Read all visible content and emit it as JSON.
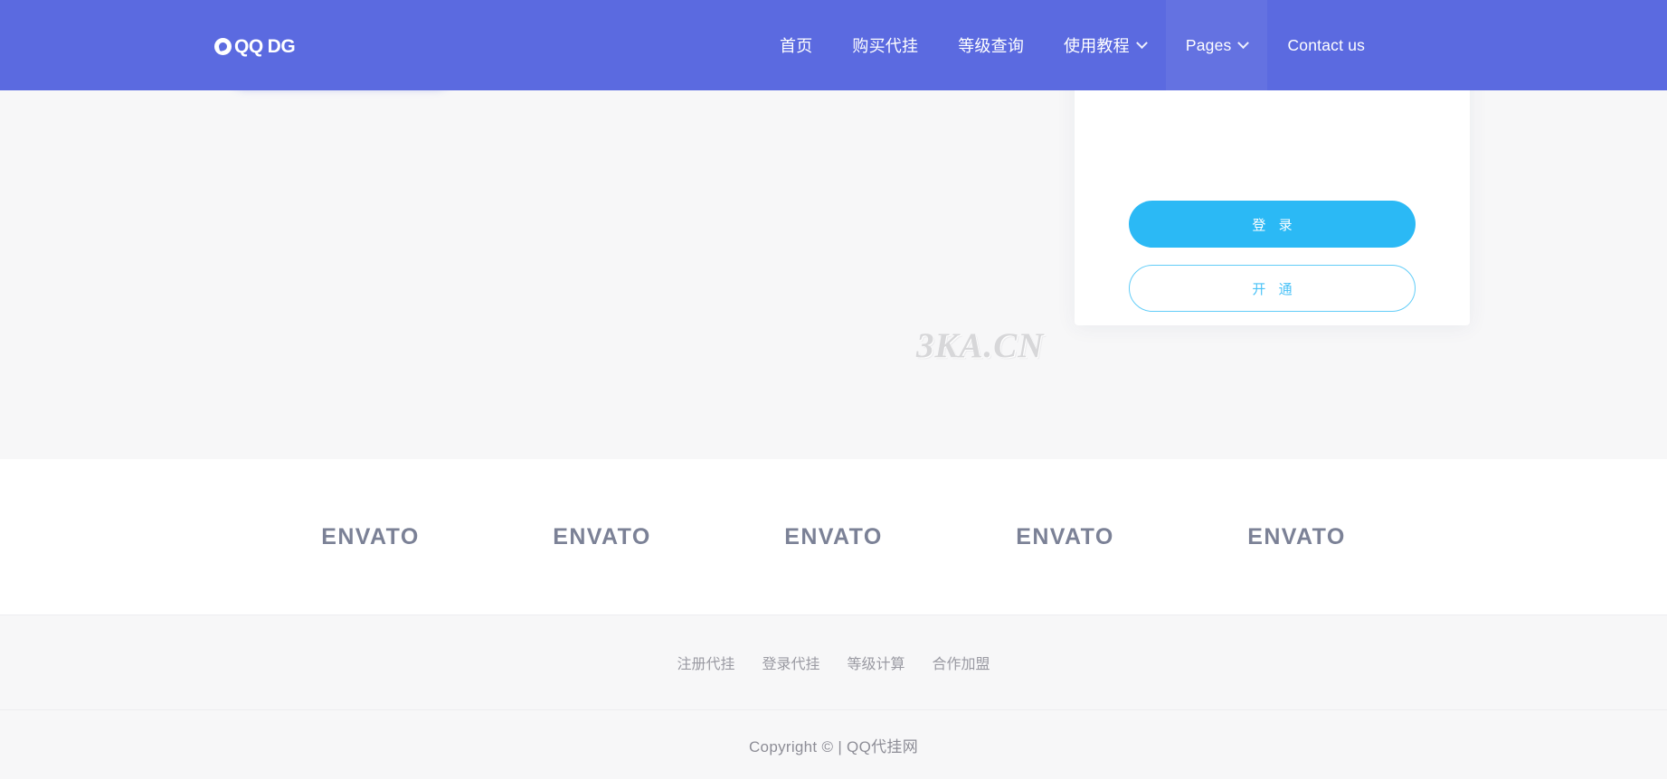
{
  "header": {
    "background_color": "#5b6ae0",
    "logo": {
      "icon": "qq-circle-icon",
      "text_part1": "QQ",
      "text_part2": "DG",
      "full_text": "QQ DG"
    },
    "nav_items": [
      {
        "label": "首页",
        "lang": "cn",
        "has_caret": false,
        "active": false
      },
      {
        "label": "购买代挂",
        "lang": "cn",
        "has_caret": false,
        "active": false
      },
      {
        "label": "等级查询",
        "lang": "cn",
        "has_caret": false,
        "active": false
      },
      {
        "label": "使用教程",
        "lang": "cn",
        "has_caret": true,
        "active": false
      },
      {
        "label": "Pages",
        "lang": "en",
        "has_caret": true,
        "active": true
      },
      {
        "label": "Contact us",
        "lang": "en",
        "has_caret": false,
        "active": false
      }
    ]
  },
  "hero": {
    "background_color": "#f7f7f8",
    "watermark": "3KA.CN",
    "login_card": {
      "primary_button": "登 录",
      "outline_button": "开 通",
      "primary_color": "#2bb9f5",
      "outline_border_color": "#62cdf8"
    }
  },
  "partners": {
    "logos": [
      {
        "label": "ENVATO"
      },
      {
        "label": "ENVATO"
      },
      {
        "label": "ENVATO"
      },
      {
        "label": "ENVATO"
      },
      {
        "label": "ENVATO"
      }
    ]
  },
  "footer": {
    "links": [
      {
        "label": "注册代挂"
      },
      {
        "label": "登录代挂"
      },
      {
        "label": "等级计算"
      },
      {
        "label": "合作加盟"
      }
    ],
    "copyright": "Copyright © | QQ代挂网"
  }
}
